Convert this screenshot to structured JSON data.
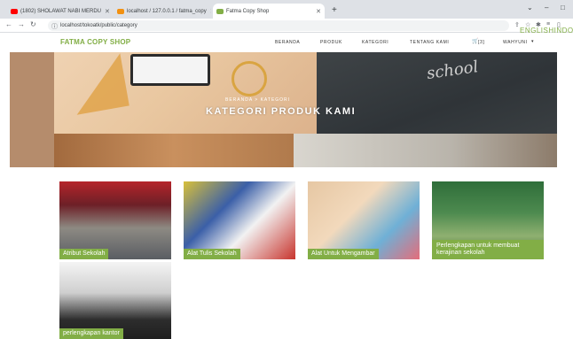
{
  "browser": {
    "tabs": [
      {
        "title": "(1802) SHOLAWAT NABI MERDU",
        "favicon_color": "#ff0000"
      },
      {
        "title": "localhost / 127.0.0.1 / fatma_copy",
        "favicon_color": "#f29111"
      },
      {
        "title": "Fatma Copy Shop",
        "favicon_color": "#82ae46"
      }
    ],
    "new_tab": "+",
    "url": "localhost/tokoatk/public/category"
  },
  "site": {
    "logo": "FATMA COPY SHOP",
    "nav": [
      "BERANDA",
      "PRODUK",
      "KATEGORI",
      "TENTANG KAMI",
      "[3]",
      "WAHYUNI"
    ],
    "partial_text": "ENGLISHINDON",
    "accent_color": "#82ae46"
  },
  "hero": {
    "breadcrumb": "BERANDA > KATEGORI",
    "title": "KATEGORI PRODUK KAMI"
  },
  "categories": [
    {
      "label": "Atribut Sekolah"
    },
    {
      "label": "Alat Tulis Sekolah"
    },
    {
      "label": "Alat Untuk Mengambar"
    },
    {
      "label": "Perlengkapan untuk membuat kerajinan sekolah"
    },
    {
      "label": "perlengkapan kantor"
    }
  ]
}
